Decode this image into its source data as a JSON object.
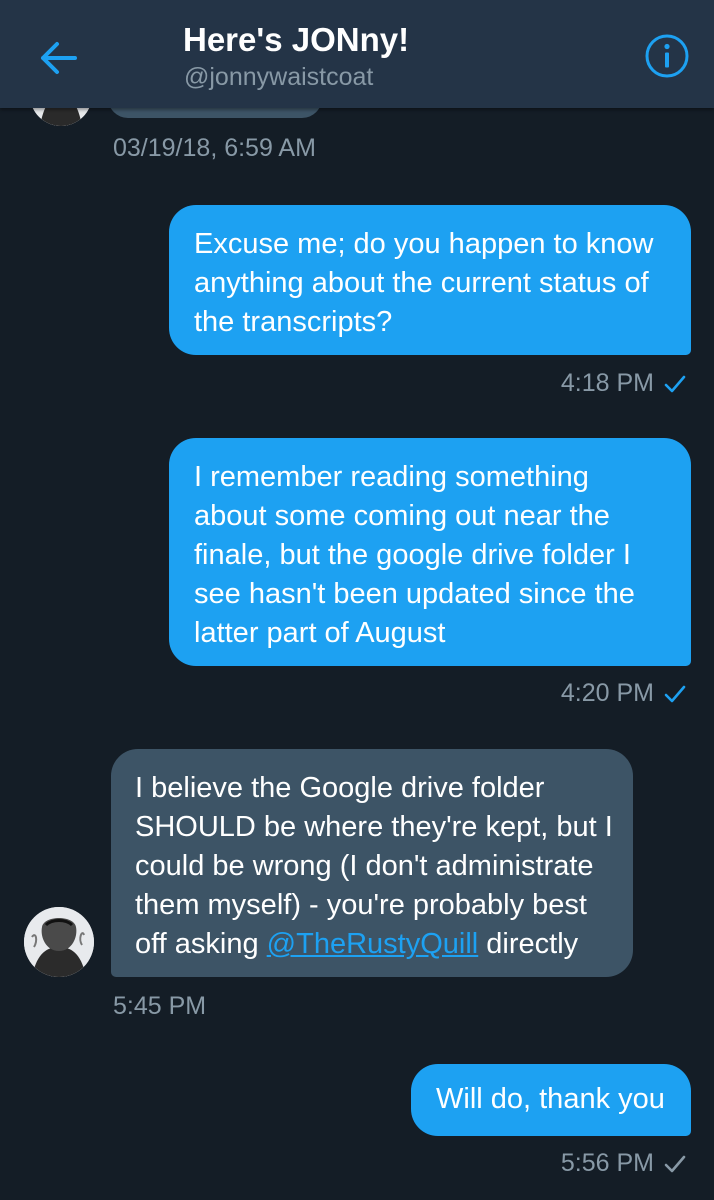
{
  "header": {
    "title": "Here's JONny!",
    "handle": "@jonnywaistcoat",
    "back_icon": "arrow-left-icon",
    "info_icon": "info-circle-icon",
    "accent": "#1da1f2"
  },
  "thread": {
    "prev_timestamp": "03/19/18, 6:59 AM",
    "messages": [
      {
        "from": "me",
        "lines": [
          "Excuse me; do you happen to know",
          "anything about the current status of",
          "the transcripts?"
        ],
        "time": "4:18 PM",
        "status": "read"
      },
      {
        "from": "me",
        "lines": [
          "I remember reading something",
          "about some coming out near the",
          "finale, but the google drive folder I",
          "see hasn't been updated since the",
          "latter part of August"
        ],
        "time": "4:20 PM",
        "status": "read"
      },
      {
        "from": "them",
        "lines": [
          "I believe the Google drive folder",
          "SHOULD be where they're kept, but I",
          "could be wrong (I don't administrate",
          "them myself) - you're probably best"
        ],
        "last_line_before": "off asking ",
        "mention": "@TheRustyQuill",
        "last_line_after": " directly",
        "time": "5:45 PM"
      },
      {
        "from": "me",
        "lines": [
          "Will do, thank you"
        ],
        "time": "5:56 PM",
        "status": "sent"
      }
    ]
  },
  "colors": {
    "background": "#141d26",
    "header": "#243447",
    "sent_bubble": "#1da1f2",
    "received_bubble": "#3d5466",
    "meta_text": "#8899a6"
  }
}
